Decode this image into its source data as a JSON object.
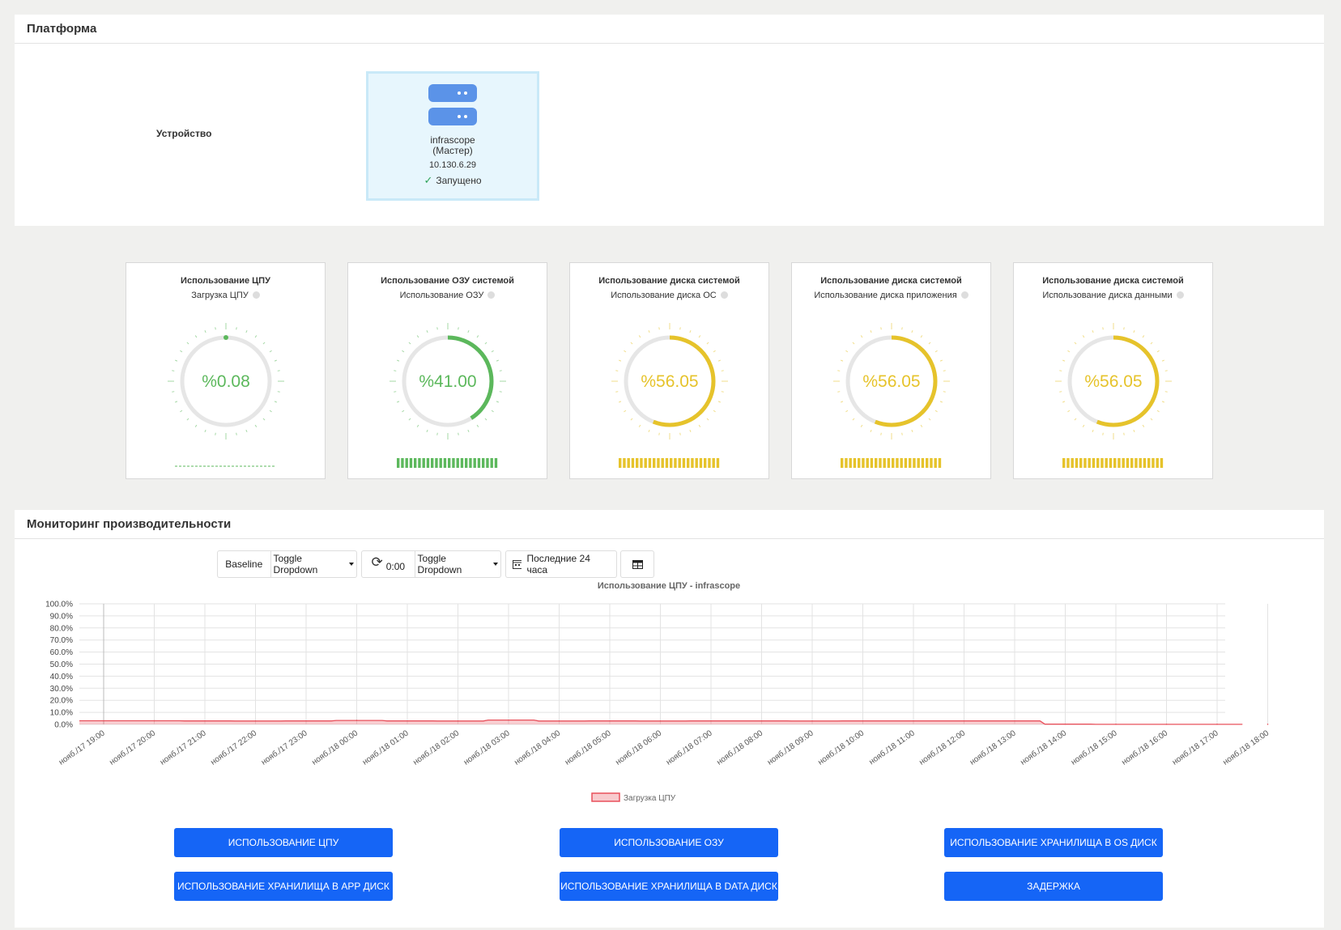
{
  "platform": {
    "title": "Платформа",
    "device_label": "Устройство",
    "device": {
      "name_line1": "infrascope",
      "name_line2": "(Мастер)",
      "ip": "10.130.6.29",
      "status": "Запущено"
    }
  },
  "gauges": [
    {
      "title": "Использование ЦПУ",
      "subtitle": "Загрузка ЦПУ",
      "value_text": "%0.08",
      "value": 0.08,
      "color": "#5cb85c"
    },
    {
      "title": "Использование ОЗУ системой",
      "subtitle": "Использование ОЗУ",
      "value_text": "%41.00",
      "value": 41.0,
      "color": "#5cb85c"
    },
    {
      "title": "Использование диска системой",
      "subtitle": "Использование диска ОС",
      "value_text": "%56.05",
      "value": 56.05,
      "color": "#e6c32b"
    },
    {
      "title": "Использование диска системой",
      "subtitle": "Использование диска приложения",
      "value_text": "%56.05",
      "value": 56.05,
      "color": "#e6c32b"
    },
    {
      "title": "Использование диска системой",
      "subtitle": "Использование диска данными",
      "value_text": "%56.05",
      "value": 56.05,
      "color": "#e6c32b"
    }
  ],
  "performance": {
    "title": "Мониторинг производительности",
    "toolbar": {
      "baseline": "Baseline",
      "toggle1": "Toggle Dropdown",
      "refresh_value": "0:00",
      "toggle2": "Toggle Dropdown",
      "range": "Последние 24 часа"
    }
  },
  "chart_data": {
    "type": "area",
    "title": "Использование ЦПУ - infrascope",
    "y_ticks": [
      "100.0%",
      "90.0%",
      "80.0%",
      "70.0%",
      "60.0%",
      "50.0%",
      "40.0%",
      "30.0%",
      "20.0%",
      "10.0%",
      "0.0%"
    ],
    "ylim": [
      0,
      100
    ],
    "x_ticks": [
      "нояб./17 19:00",
      "нояб./17 20:00",
      "нояб./17 21:00",
      "нояб./17 22:00",
      "нояб./17 23:00",
      "нояб./18 00:00",
      "нояб./18 01:00",
      "нояб./18 02:00",
      "нояб./18 03:00",
      "нояб./18 04:00",
      "нояб./18 05:00",
      "нояб./18 06:00",
      "нояб./18 07:00",
      "нояб./18 08:00",
      "нояб./18 09:00",
      "нояб./18 10:00",
      "нояб./18 11:00",
      "нояб./18 12:00",
      "нояб./18 13:00",
      "нояб./18 14:00",
      "нояб./18 15:00",
      "нояб./18 16:00",
      "нояб./18 17:00",
      "нояб./18 18:00"
    ],
    "grid": true,
    "legend_position": "bottom",
    "series": [
      {
        "name": "Загрузка ЦПУ",
        "color": "#e8505b",
        "x": [
          "нояб./17 19:00",
          "нояб./17 20:00",
          "нояб./17 21:00",
          "нояб./17 22:00",
          "нояб./17 23:00",
          "нояб./18 00:00",
          "нояб./18 01:00",
          "нояб./18 02:00",
          "нояб./18 03:00",
          "нояб./18 04:00",
          "нояб./18 05:00",
          "нояб./18 06:00",
          "нояб./18 07:00",
          "нояб./18 08:00",
          "нояб./18 09:00",
          "нояб./18 10:00",
          "нояб./18 11:00",
          "нояб./18 12:00",
          "нояб./18 13:00",
          "нояб./18 14:00",
          "нояб./18 15:00",
          "нояб./18 16:00",
          "нояб./18 17:00",
          "нояб./18 18:00"
        ],
        "values": [
          3.0,
          3.0,
          2.9,
          2.8,
          2.9,
          3.3,
          2.9,
          2.8,
          3.6,
          2.8,
          2.9,
          2.8,
          2.9,
          2.9,
          2.8,
          2.9,
          2.9,
          2.9,
          2.9,
          0.2,
          0.1,
          0.1,
          0.1,
          0.1
        ]
      }
    ]
  },
  "buttons": [
    "Использование ЦПУ",
    "Использование ОЗУ",
    "Использование хранилища в OS диск",
    "Использование хранилища в APP диск",
    "Использование хранилища в DATA диск",
    "Задержка"
  ]
}
